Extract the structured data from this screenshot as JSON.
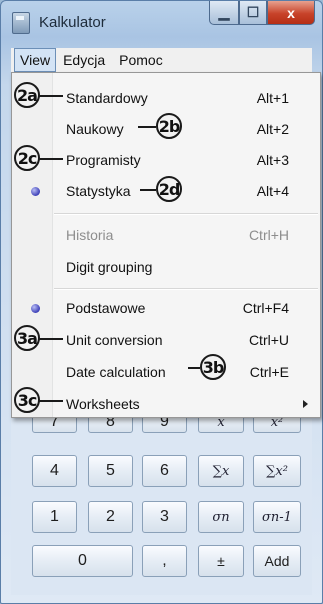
{
  "window": {
    "title": "Kalkulator",
    "close_glyph": "x"
  },
  "menubar": {
    "items": [
      "View",
      "Edycja",
      "Pomoc"
    ]
  },
  "menu": {
    "items": [
      {
        "label": "Standardowy",
        "shortcut": "Alt+1"
      },
      {
        "label": "Naukowy",
        "shortcut": "Alt+2"
      },
      {
        "label": "Programisty",
        "shortcut": "Alt+3"
      },
      {
        "label": "Statystyka",
        "shortcut": "Alt+4",
        "selected": true
      },
      {
        "label": "Historia",
        "shortcut": "Ctrl+H",
        "disabled": true
      },
      {
        "label": "Digit grouping",
        "shortcut": ""
      },
      {
        "label": "Podstawowe",
        "shortcut": "Ctrl+F4",
        "selected": true
      },
      {
        "label": "Unit conversion",
        "shortcut": "Ctrl+U"
      },
      {
        "label": "Date calculation",
        "shortcut": "Ctrl+E"
      },
      {
        "label": "Worksheets",
        "shortcut": "",
        "submenu": true
      }
    ]
  },
  "callouts": [
    "2a",
    "2b",
    "2c",
    "2d",
    "3a",
    "3b",
    "3c"
  ],
  "keypad": {
    "row0": [
      "7",
      "8",
      "9",
      "x",
      "x²"
    ],
    "row1": [
      "4",
      "5",
      "6",
      "∑x",
      "∑x²"
    ],
    "row2": [
      "1",
      "2",
      "3",
      "σn",
      "σn-1"
    ],
    "row3": [
      "0",
      ",",
      "±",
      "Add"
    ]
  }
}
